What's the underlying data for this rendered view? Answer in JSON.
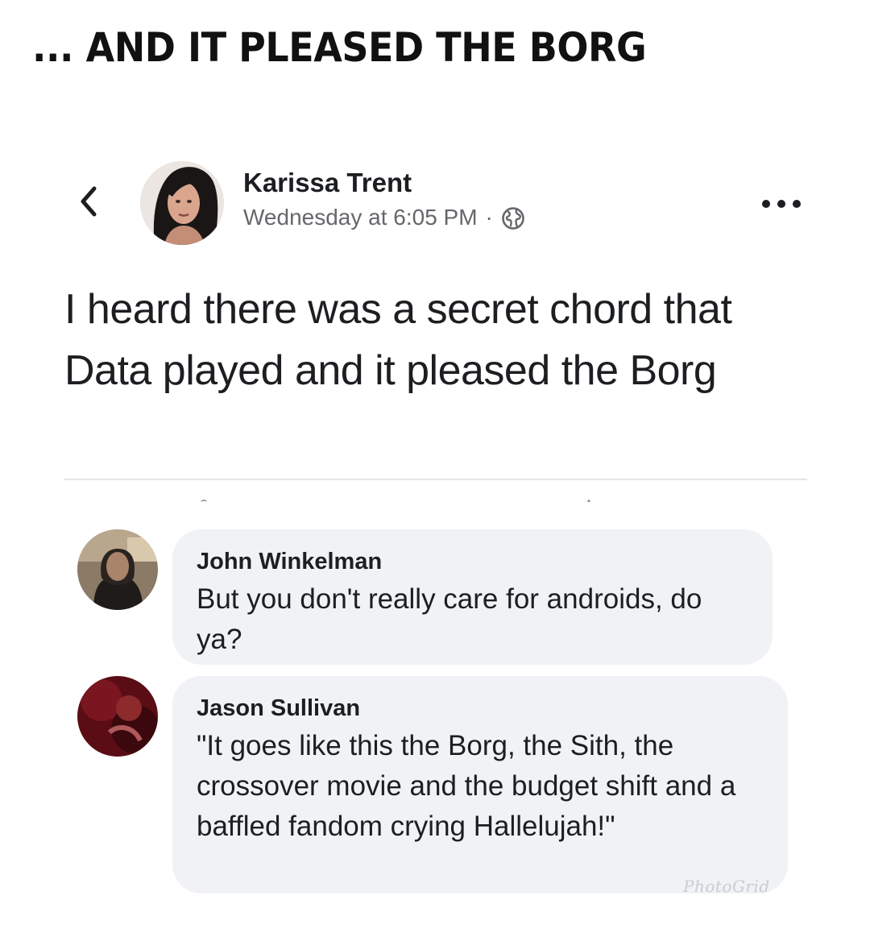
{
  "meme_title": "... AND IT PLEASED THE BORG",
  "post": {
    "author": "Karissa Trent",
    "timestamp": "Wednesday at 6:05 PM",
    "meta_separator": "·",
    "privacy_icon": "globe-icon",
    "text": "I heard there was a secret chord that Data played and it pleased the Borg"
  },
  "header_icons": {
    "back": "chevron-left-icon",
    "more": "more-horizontal-icon"
  },
  "comments": [
    {
      "author": "John Winkelman",
      "text": "But you don't really care for androids, do ya?"
    },
    {
      "author": "Jason Sullivan",
      "text": "\"It goes like this the Borg, the Sith, the crossover movie and the budget shift and a baffled fandom crying Hallelujah!\""
    }
  ],
  "watermark": "PhotoGrid",
  "colors": {
    "text_primary": "#1c1e21",
    "text_secondary": "#65676b",
    "bubble_bg": "#f0f2f5",
    "divider": "#e4e6eb"
  }
}
